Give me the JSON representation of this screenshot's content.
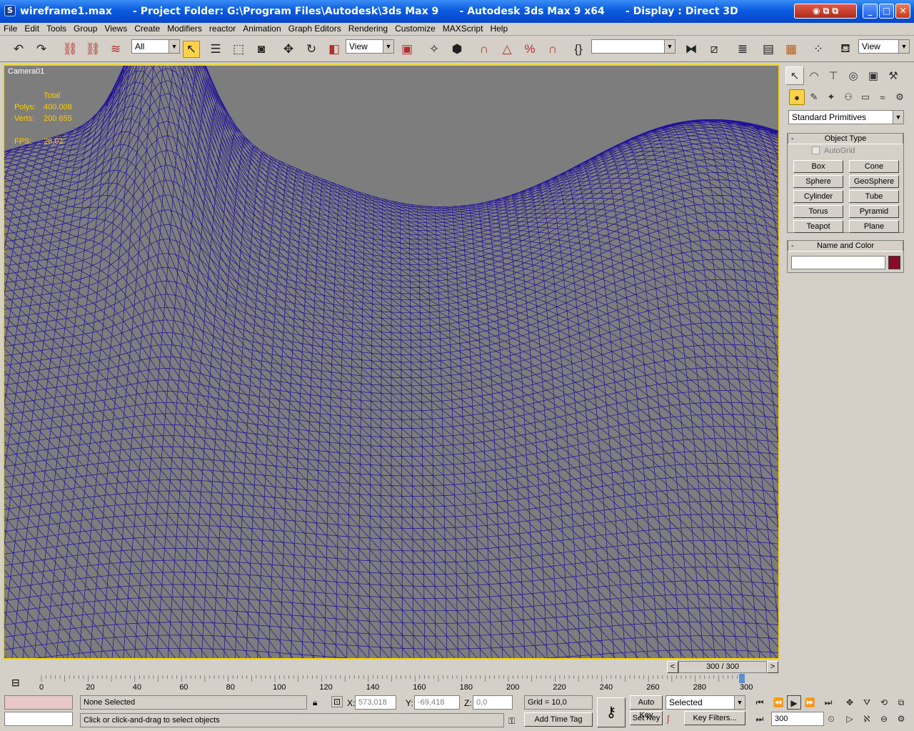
{
  "titlebar": {
    "title": "wireframe1.max      - Project Folder: G:\\Program Files\\Autodesk\\3ds Max 9      - Autodesk 3ds Max 9 x64      - Display : Direct 3D"
  },
  "menubar": {
    "items": [
      "File",
      "Edit",
      "Tools",
      "Group",
      "Views",
      "Create",
      "Modifiers",
      "reactor",
      "Animation",
      "Graph Editors",
      "Rendering",
      "Customize",
      "MAXScript",
      "Help"
    ]
  },
  "toolbar": {
    "selection_filter": "All",
    "ref_coord": "View",
    "named_selection": "",
    "render_type": "View"
  },
  "viewport": {
    "label": "Camera01",
    "stats": {
      "header": "Total",
      "polys_label": "Polys:",
      "polys": "400.008",
      "verts_label": "Verts:",
      "verts": "200.655",
      "fps_label": "FPS:",
      "fps": "28,02"
    },
    "wire_color": "#1e0e9a",
    "bg_color": "#7d7d7d"
  },
  "command_panel": {
    "category": "Standard Primitives",
    "object_type": {
      "title": "Object Type",
      "autogrid": "AutoGrid",
      "buttons": [
        "Box",
        "Cone",
        "Sphere",
        "GeoSphere",
        "Cylinder",
        "Tube",
        "Torus",
        "Pyramid",
        "Teapot",
        "Plane"
      ]
    },
    "name_color": {
      "title": "Name and Color",
      "name_value": "",
      "color": "#8a0a2a"
    },
    "collapse_symbol": "-"
  },
  "time": {
    "slider": "300 / 300",
    "prev": "<",
    "next": ">",
    "ticks": [
      "0",
      "20",
      "40",
      "60",
      "80",
      "100",
      "120",
      "140",
      "160",
      "180",
      "200",
      "220",
      "240",
      "260",
      "280",
      "300"
    ]
  },
  "status": {
    "selection": "None Selected",
    "prompt": "Click or click-and-drag to select objects",
    "x_label": "X:",
    "x": "573,018",
    "y_label": "Y:",
    "y": "-69,418",
    "z_label": "Z:",
    "z": "0,0",
    "grid": "Grid = 10,0",
    "add_time_tag": "Add Time Tag",
    "auto_key": "Auto Key",
    "set_key": "Set Key",
    "key_mode": "Selected",
    "key_filters": "Key Filters...",
    "frame": "300"
  }
}
